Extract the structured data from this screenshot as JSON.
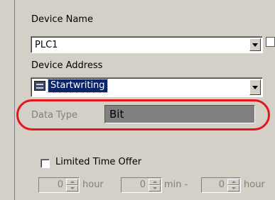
{
  "device_name": {
    "label": "Device Name",
    "value": "PLC1"
  },
  "device_address": {
    "label": "Device Address",
    "value": "Startwriting"
  },
  "data_type": {
    "label": "Data Type",
    "value": "Bit"
  },
  "limited_time_offer": {
    "label": "Limited Time Offer",
    "checked": false
  },
  "timer": {
    "hour_value": "0",
    "hour_label": "hour",
    "min_value": "0",
    "min_label": "min -",
    "hour2_value": "0",
    "hour2_label": "hour"
  },
  "colors": {
    "highlight": "#e4161b",
    "selection": "#0a246a",
    "dialog_bg": "#d4d0c8"
  }
}
